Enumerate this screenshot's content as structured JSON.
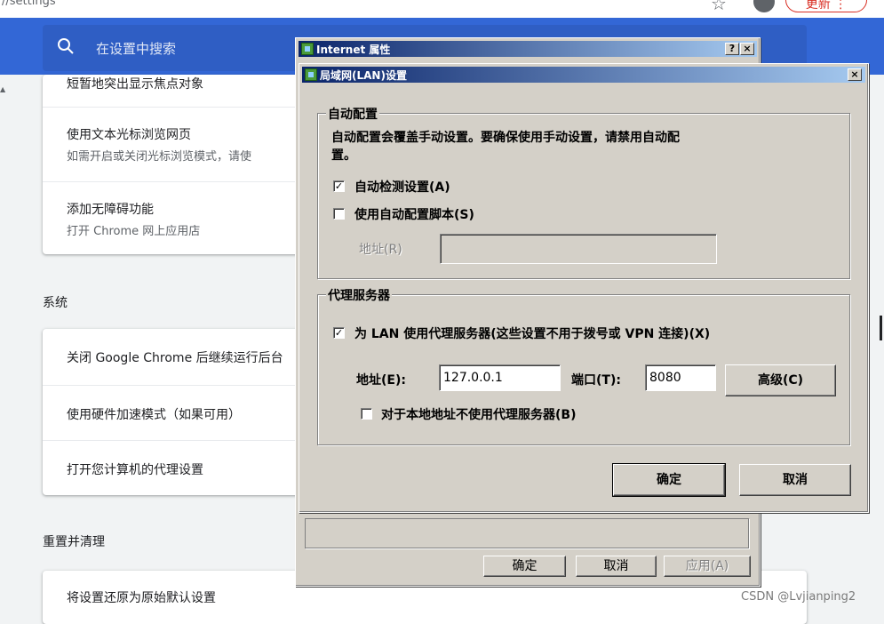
{
  "browser": {
    "url_fragment": "//settings",
    "update_label": "更新 ⋮"
  },
  "search": {
    "placeholder": "在设置中搜索"
  },
  "accessibility": {
    "partial_top": "短暂地突出显示焦点对象",
    "items": [
      {
        "title": "使用文本光标浏览网页",
        "subtitle": "如需开启或关闭光标浏览模式，请使"
      },
      {
        "title": "添加无障碍功能",
        "subtitle": "打开 Chrome 网上应用店"
      }
    ]
  },
  "system": {
    "heading": "系统",
    "items": [
      "关闭 Google Chrome 后继续运行后台",
      "使用硬件加速模式（如果可用）",
      "打开您计算机的代理设置"
    ]
  },
  "reset": {
    "heading": "重置并清理",
    "item": "将设置还原为原始默认设置"
  },
  "internet_props": {
    "title": "Internet 属性",
    "help_btn": "?",
    "close_btn": "×",
    "ok": "确定",
    "cancel": "取消",
    "apply": "应用(A)"
  },
  "lan_dialog": {
    "title": "局域网(LAN)设置",
    "close_btn": "×",
    "auto_config": {
      "legend": "自动配置",
      "desc_line1": "自动配置会覆盖手动设置。要确保使用手动设置，请禁用自动配",
      "desc_line2": "置。",
      "auto_detect": {
        "label": "自动检测设置(A)",
        "checked": true
      },
      "use_script": {
        "label": "使用自动配置脚本(S)",
        "checked": false
      },
      "address_label": "地址(R)",
      "address_value": ""
    },
    "proxy": {
      "legend": "代理服务器",
      "use_proxy": {
        "label": "为 LAN 使用代理服务器(这些设置不用于拨号或 VPN 连接)(X)",
        "checked": true
      },
      "address_label": "地址(E):",
      "address_value": "127.0.0.1",
      "port_label": "端口(T):",
      "port_value": "8080",
      "advanced": "高级(C)",
      "bypass_local": {
        "label": "对于本地地址不使用代理服务器(B)",
        "checked": false
      }
    },
    "ok": "确定",
    "cancel": "取消"
  },
  "watermark": "CSDN @Lvjianping2",
  "colors": {
    "chrome_blue": "#3367d6",
    "win_face": "#d4d0c8",
    "title_start": "#0a246a",
    "title_end": "#a6caf0"
  }
}
